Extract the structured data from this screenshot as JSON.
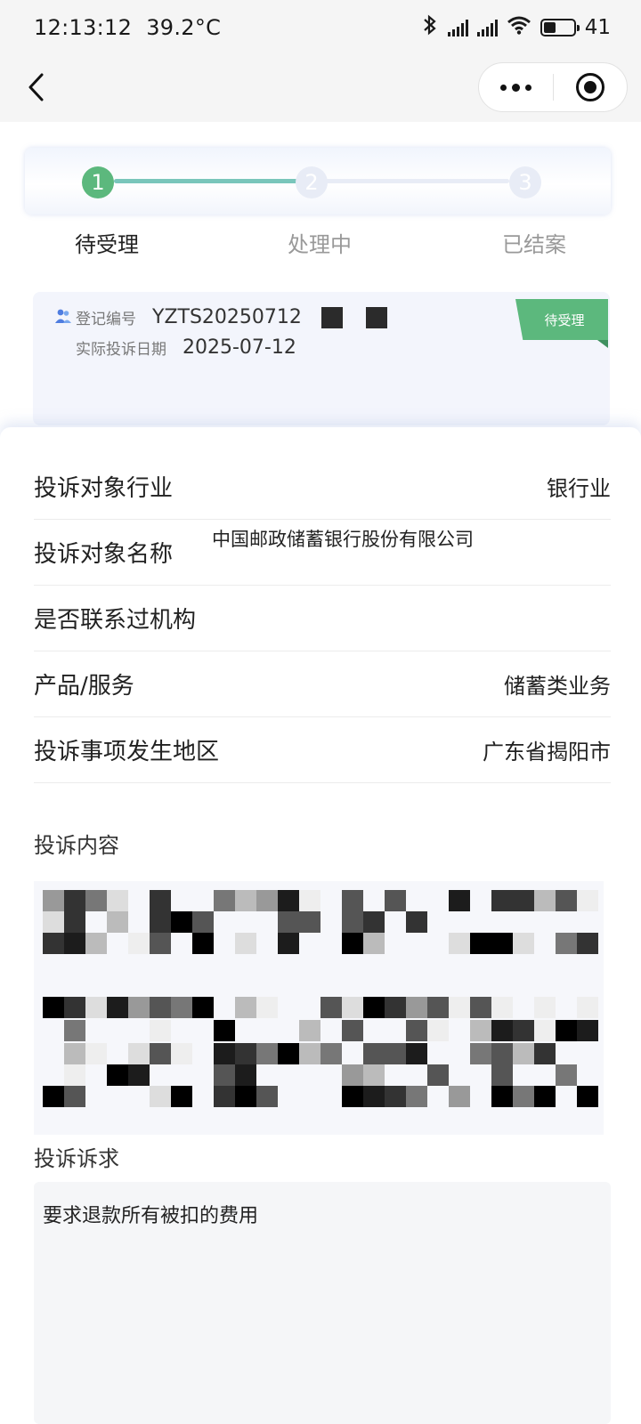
{
  "status_bar": {
    "time": "12:13:12",
    "temperature": "39.2°C",
    "battery_level": "41",
    "battery_fraction": 0.41,
    "icons": [
      "bluetooth-icon",
      "signal-icon",
      "signal-icon",
      "wifi-icon",
      "battery-icon"
    ]
  },
  "nav": {
    "back_icon": "chevron-left-icon",
    "more_icon": "more-dots-icon",
    "close_icon": "target-circle-icon"
  },
  "steps": [
    {
      "number": "1",
      "label": "待受理",
      "active": true
    },
    {
      "number": "2",
      "label": "处理中",
      "active": false
    },
    {
      "number": "3",
      "label": "已结案",
      "active": false
    }
  ],
  "registration": {
    "number_label": "登记编号",
    "number_value": "YZTS20250712",
    "date_label": "实际投诉日期",
    "date_value": "2025-07-12",
    "status_badge": "待受理",
    "people_icon": "people-icon"
  },
  "details": [
    {
      "key": "投诉对象行业",
      "value": "银行业"
    },
    {
      "key": "投诉对象名称",
      "value": "中国邮政储蓄银行股份有限公司"
    },
    {
      "key": "是否联系过机构",
      "value": ""
    },
    {
      "key": "产品/服务",
      "value": "储蓄类业务"
    },
    {
      "key": "投诉事项发生地区",
      "value": "广东省揭阳市"
    }
  ],
  "content": {
    "title": "投诉内容"
  },
  "request": {
    "title": "投诉诉求",
    "text": "要求退款所有被扣的费用"
  },
  "colors": {
    "accent_green": "#5cb87d",
    "step_line_active": "#7ac6bb",
    "step_inactive": "#e8ecf6"
  }
}
